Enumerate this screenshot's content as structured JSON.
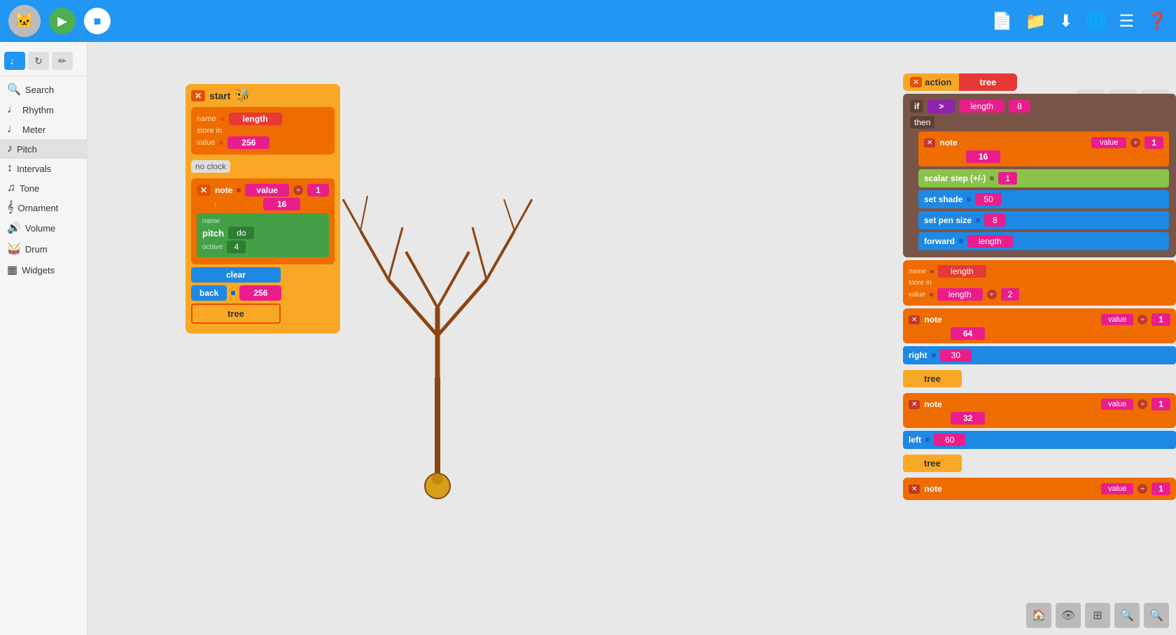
{
  "topbar": {
    "play_label": "▶",
    "stop_label": "■",
    "icons": [
      "➕",
      "📁",
      "⬇",
      "🌐",
      "☰",
      "❓"
    ]
  },
  "sidebar": {
    "tabs": [
      {
        "label": "♩♩",
        "active": true
      },
      {
        "label": "↻",
        "active": false
      },
      {
        "label": "✏",
        "active": false
      }
    ],
    "items": [
      {
        "icon": "🔍",
        "label": "Search"
      },
      {
        "icon": "♩",
        "label": "Rhythm"
      },
      {
        "icon": "♩",
        "label": "Meter"
      },
      {
        "icon": "♪",
        "label": "Pitch",
        "active": true
      },
      {
        "icon": "↕",
        "label": "Intervals"
      },
      {
        "icon": "♫",
        "label": "Tone"
      },
      {
        "icon": "𝄞",
        "label": "Ornament"
      },
      {
        "icon": "🔊",
        "label": "Volume"
      },
      {
        "icon": "🥁",
        "label": "Drum"
      },
      {
        "icon": "▦",
        "label": "Widgets"
      }
    ]
  },
  "blocks_left": {
    "start_label": "start",
    "name_label": "name",
    "length_value": "length",
    "store_in_label": "store in",
    "value_label": "value",
    "value_num": "256",
    "no_clock_label": "no clock",
    "note_label": "note",
    "value_1": "1",
    "value_16": "16",
    "pitch_label": "pitch",
    "name2": "name",
    "do_label": "do",
    "octave_label": "octave",
    "octave_val": "4",
    "clear_label": "clear",
    "back_label": "back",
    "back_val": "256",
    "tree_label": "tree"
  },
  "blocks_right": {
    "action_label": "action",
    "tree_label": "tree",
    "if_label": "if",
    "gt_label": ">",
    "length_label": "length",
    "value_8": "8",
    "then_label": "then",
    "note_label": "note",
    "value_1a": "1",
    "value_16a": "16",
    "scalar_label": "scalar step (+/-)",
    "scalar_val": "1",
    "set_shade_label": "set shade",
    "shade_val": "50",
    "set_pen_label": "set pen size",
    "pen_val": "8",
    "forward_label": "forward",
    "length2": "length",
    "name_label2": "name",
    "length_name": "length",
    "store_in2": "store in",
    "length_val2": "length",
    "divide_val": "2",
    "note2_label": "note",
    "val_1b": "1",
    "val_64": "64",
    "right_label": "right",
    "right_val": "30",
    "tree2_label": "tree",
    "note3_label": "note",
    "val_1c": "1",
    "val_32": "32",
    "left_label": "left",
    "left_val": "60",
    "tree3_label": "tree",
    "note4_label": "note",
    "val_1d": "1"
  },
  "bottom_toolbar": {
    "icons": [
      "🏠",
      "👁",
      "⊞",
      "🔍",
      "🔍+"
    ]
  },
  "top_toolbar_right": {
    "icons": [
      "⊞",
      "✏",
      "✕"
    ]
  }
}
